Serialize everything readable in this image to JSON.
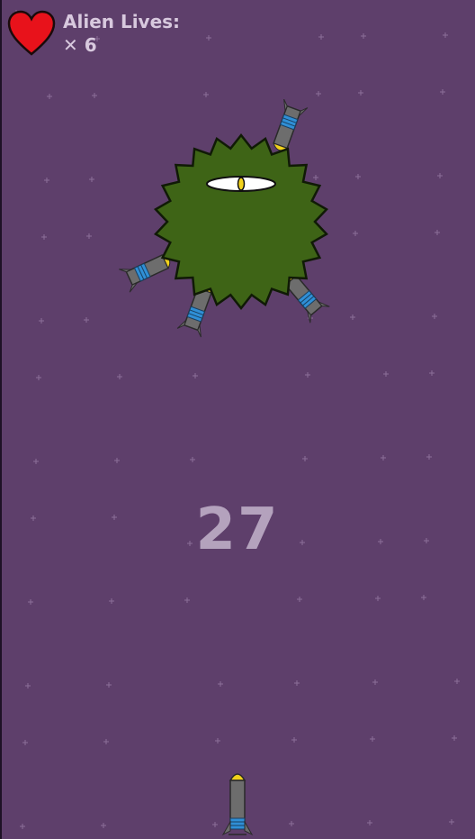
{
  "hud": {
    "lives_label": "Alien Lives:",
    "lives_count": "✕ 6",
    "heart_icon": "heart-icon",
    "heart_color": "#e8121b"
  },
  "score": "27",
  "alien": {
    "icon": "alien-monster-icon",
    "body_color": "#3e6416",
    "eye_pupil_color": "#f2d21c",
    "stuck_rockets": 4
  },
  "player": {
    "icon": "rocket-icon",
    "tip_color": "#f2d21c",
    "band_color": "#2f8fd6"
  },
  "colors": {
    "background": "#5e3f6b",
    "text": "#d8c9de",
    "score": "#b4a2bd"
  }
}
